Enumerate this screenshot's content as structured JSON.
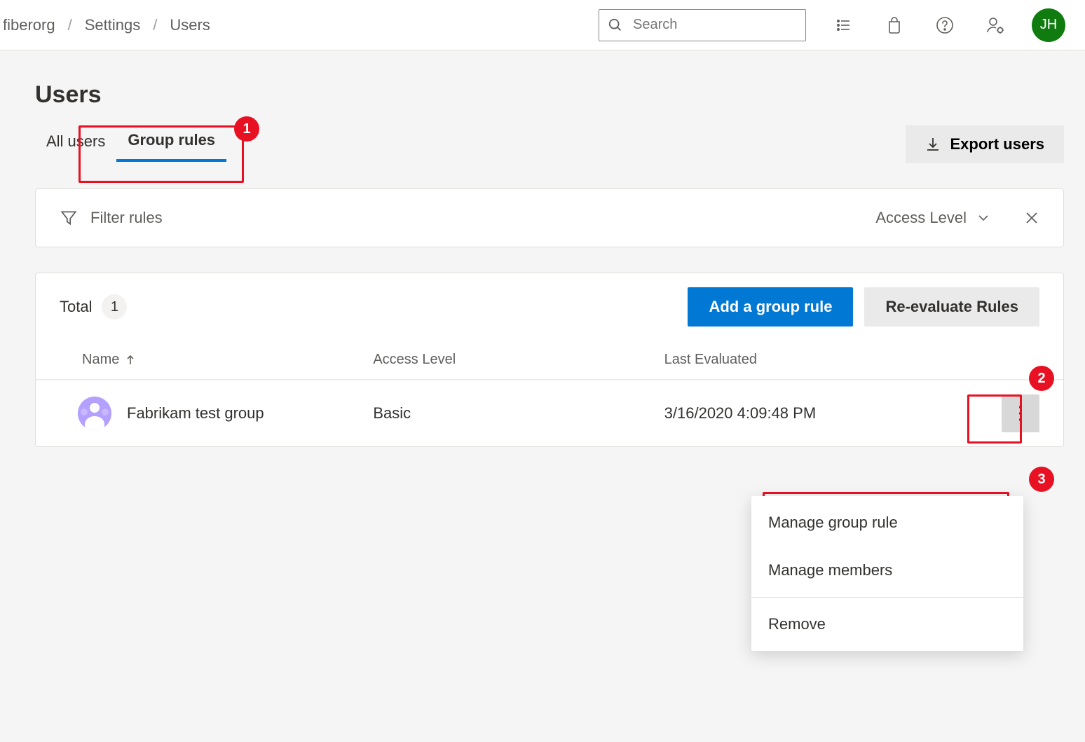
{
  "header": {
    "breadcrumb": [
      "fiberorg",
      "Settings",
      "Users"
    ],
    "search_placeholder": "Search",
    "avatar_initials": "JH"
  },
  "page": {
    "title": "Users",
    "tabs": [
      {
        "label": "All users",
        "active": false
      },
      {
        "label": "Group rules",
        "active": true
      }
    ],
    "export_label": "Export users"
  },
  "filter": {
    "placeholder": "Filter rules",
    "column_label": "Access Level"
  },
  "table": {
    "total_label": "Total",
    "total_count": "1",
    "add_button": "Add a group rule",
    "reevaluate_button": "Re-evaluate Rules",
    "columns": {
      "name": "Name",
      "access": "Access Level",
      "evaluated": "Last Evaluated"
    },
    "rows": [
      {
        "name": "Fabrikam test group",
        "access": "Basic",
        "evaluated": "3/16/2020 4:09:48 PM"
      }
    ]
  },
  "context_menu": {
    "items": [
      "Manage group rule",
      "Manage members",
      "Remove"
    ]
  },
  "annotations": [
    "1",
    "2",
    "3"
  ]
}
